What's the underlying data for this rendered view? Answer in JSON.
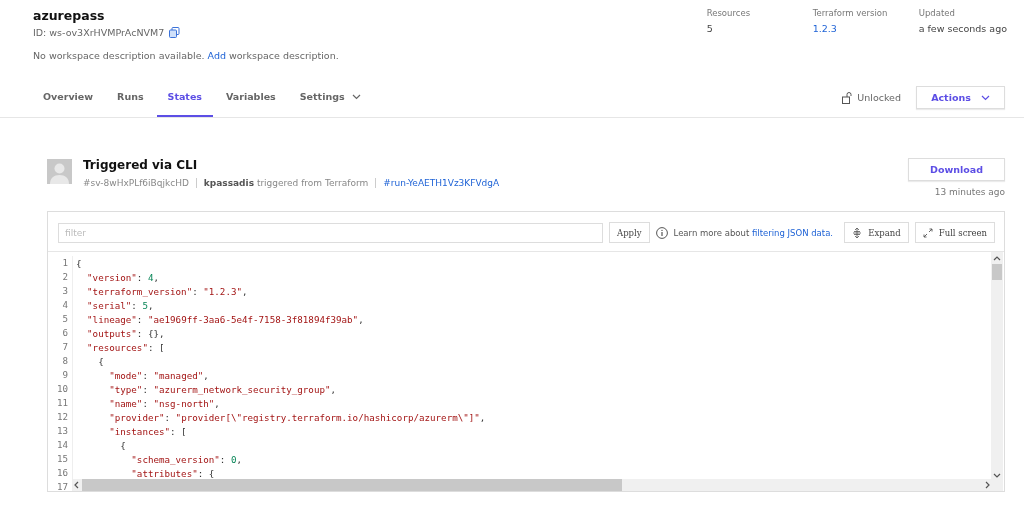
{
  "workspace": {
    "name": "azurepass",
    "id": "ID: ws-ov3XrHVMPrAcNVM7",
    "description_before": "No workspace description available.",
    "description_link": "Add",
    "description_after": "workspace description."
  },
  "stats": [
    {
      "label": "Resources",
      "value": "5",
      "link": false
    },
    {
      "label": "Terraform version",
      "value": "1.2.3",
      "link": true
    },
    {
      "label": "Updated",
      "value": "a few seconds ago",
      "link": false
    }
  ],
  "tabs": [
    {
      "label": "Overview",
      "selected": false,
      "dropdown": false
    },
    {
      "label": "Runs",
      "selected": false,
      "dropdown": false
    },
    {
      "label": "States",
      "selected": true,
      "dropdown": false
    },
    {
      "label": "Variables",
      "selected": false,
      "dropdown": false
    },
    {
      "label": "Settings",
      "selected": false,
      "dropdown": true
    }
  ],
  "lock_status": "Unlocked",
  "actions_button": "Actions",
  "state": {
    "title": "Triggered via CLI",
    "serial_id": "#sv-8wHxPLf6iBqjkcHD",
    "user": "kpassadis",
    "trigger_text": "triggered from Terraform",
    "run_link": "#run-YeAETH1Vz3KFVdgA",
    "download_button": "Download",
    "time": "13 minutes ago"
  },
  "viewer": {
    "filter_placeholder": "filter",
    "apply_button": "Apply",
    "help_before": "Learn more about",
    "help_link": "filtering JSON data.",
    "expand_button": "Expand",
    "fullscreen_button": "Full screen",
    "lines": [
      {
        "number": "1",
        "tokens": [
          {
            "kind": "punct",
            "text": "{"
          }
        ]
      },
      {
        "number": "2",
        "tokens": [
          {
            "kind": "key",
            "text": "  \"version\""
          },
          {
            "kind": "punct",
            "text": ": "
          },
          {
            "kind": "number",
            "text": "4"
          },
          {
            "kind": "punct",
            "text": ","
          }
        ]
      },
      {
        "number": "3",
        "tokens": [
          {
            "kind": "key",
            "text": "  \"terraform_version\""
          },
          {
            "kind": "punct",
            "text": ": "
          },
          {
            "kind": "string",
            "text": "\"1.2.3\""
          },
          {
            "kind": "punct",
            "text": ","
          }
        ]
      },
      {
        "number": "4",
        "tokens": [
          {
            "kind": "key",
            "text": "  \"serial\""
          },
          {
            "kind": "punct",
            "text": ": "
          },
          {
            "kind": "number",
            "text": "5"
          },
          {
            "kind": "punct",
            "text": ","
          }
        ]
      },
      {
        "number": "5",
        "tokens": [
          {
            "kind": "key",
            "text": "  \"lineage\""
          },
          {
            "kind": "punct",
            "text": ": "
          },
          {
            "kind": "string",
            "text": "\"ae1969ff-3aa6-5e4f-7158-3f81894f39ab\""
          },
          {
            "kind": "punct",
            "text": ","
          }
        ]
      },
      {
        "number": "6",
        "tokens": [
          {
            "kind": "key",
            "text": "  \"outputs\""
          },
          {
            "kind": "punct",
            "text": ": {},"
          }
        ]
      },
      {
        "number": "7",
        "tokens": [
          {
            "kind": "key",
            "text": "  \"resources\""
          },
          {
            "kind": "punct",
            "text": ": ["
          }
        ]
      },
      {
        "number": "8",
        "tokens": [
          {
            "kind": "punct",
            "text": "    {"
          }
        ]
      },
      {
        "number": "9",
        "tokens": [
          {
            "kind": "key",
            "text": "      \"mode\""
          },
          {
            "kind": "punct",
            "text": ": "
          },
          {
            "kind": "string",
            "text": "\"managed\""
          },
          {
            "kind": "punct",
            "text": ","
          }
        ]
      },
      {
        "number": "10",
        "tokens": [
          {
            "kind": "key",
            "text": "      \"type\""
          },
          {
            "kind": "punct",
            "text": ": "
          },
          {
            "kind": "string",
            "text": "\"azurerm_network_security_group\""
          },
          {
            "kind": "punct",
            "text": ","
          }
        ]
      },
      {
        "number": "11",
        "tokens": [
          {
            "kind": "key",
            "text": "      \"name\""
          },
          {
            "kind": "punct",
            "text": ": "
          },
          {
            "kind": "string",
            "text": "\"nsg-north\""
          },
          {
            "kind": "punct",
            "text": ","
          }
        ]
      },
      {
        "number": "12",
        "tokens": [
          {
            "kind": "key",
            "text": "      \"provider\""
          },
          {
            "kind": "punct",
            "text": ": "
          },
          {
            "kind": "string",
            "text": "\"provider[\\\"registry.terraform.io/hashicorp/azurerm\\\"]\""
          },
          {
            "kind": "punct",
            "text": ","
          }
        ]
      },
      {
        "number": "13",
        "tokens": [
          {
            "kind": "key",
            "text": "      \"instances\""
          },
          {
            "kind": "punct",
            "text": ": ["
          }
        ]
      },
      {
        "number": "14",
        "tokens": [
          {
            "kind": "punct",
            "text": "        {"
          }
        ]
      },
      {
        "number": "15",
        "tokens": [
          {
            "kind": "key",
            "text": "          \"schema_version\""
          },
          {
            "kind": "punct",
            "text": ": "
          },
          {
            "kind": "number",
            "text": "0"
          },
          {
            "kind": "punct",
            "text": ","
          }
        ]
      },
      {
        "number": "16",
        "tokens": [
          {
            "kind": "key",
            "text": "          \"attributes\""
          },
          {
            "kind": "punct",
            "text": ": {"
          }
        ]
      },
      {
        "number": "17"
      }
    ]
  }
}
